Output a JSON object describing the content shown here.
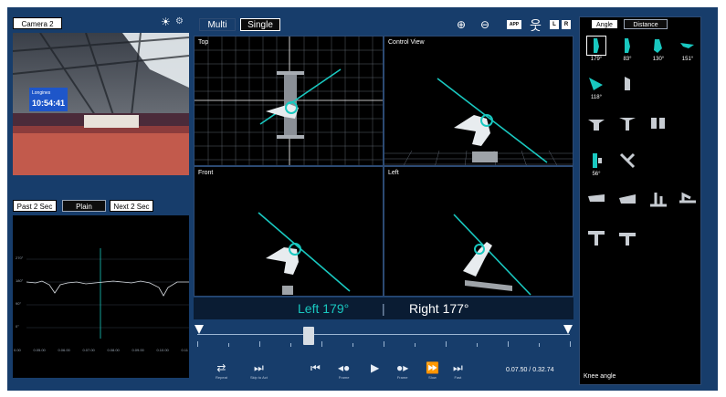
{
  "camera": {
    "label": "Camera 2",
    "scoreboard_line1": "Longines",
    "scoreboard_line2": "10:54:41"
  },
  "graph": {
    "buttons": [
      "Past 2 Sec",
      "Plain",
      "Next 2 Sec"
    ],
    "y_labels": [
      "270°",
      "180°",
      "90°",
      "0°"
    ],
    "x_labels": [
      "0.00",
      "0.05.00",
      "0.06.00",
      "0.07.00",
      "0.08.00",
      "0.09.00",
      "0.10.00",
      "0.11"
    ]
  },
  "view_mode": {
    "multi": "Multi",
    "single": "Single"
  },
  "toolbar": {
    "app_label": "APP",
    "l_label": "L",
    "r_label": "R"
  },
  "views": {
    "top": "Top",
    "control": "Control View",
    "front": "Front",
    "left": "Left"
  },
  "angles": {
    "left": "Left 179°",
    "separator": "|",
    "right": "Right 177°"
  },
  "controls": {
    "repeat": "Repeat",
    "skip": "Skip to Act",
    "frame_back": "Frame",
    "frame_fwd": "Frame",
    "slow": "Slow",
    "fast": "Fast",
    "time": "0.07.50 / 0.32.74",
    "position": 0.3
  },
  "right_panel": {
    "tabs": [
      "Angle",
      "Distance"
    ],
    "values": [
      "179°",
      "83°",
      "130°",
      "151°",
      "118°",
      "56°"
    ],
    "footer": "Knee angle"
  },
  "colors": {
    "accent": "#19c8c0",
    "frame": "#173d6b",
    "limb": "#19c8c0"
  }
}
